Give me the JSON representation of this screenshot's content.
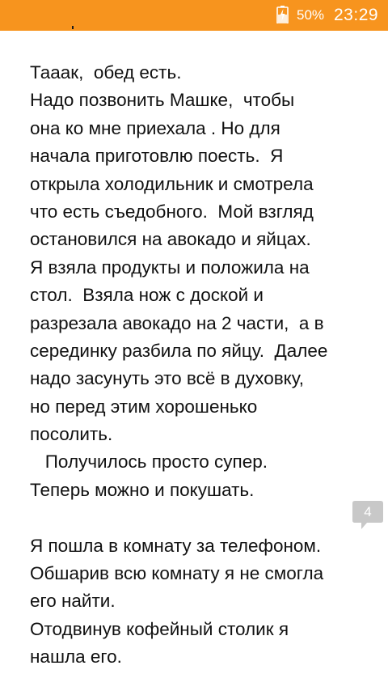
{
  "status_bar": {
    "battery": "50%",
    "time": "23:29",
    "color": "#F7941E"
  },
  "story": {
    "paragraph_1": [
      "Тааак,  обед есть.",
      "Надо позвонить Машке,  чтобы",
      "она ко мне приехала . Но для",
      "начала приготовлю поесть.  Я",
      "открыла холодильник и смотрела",
      "что есть съедобного.  Мой взгляд",
      "остановился на авокадо и яйцах.",
      "Я взяла продукты и положила на",
      "стол.  Взяла нож с доской и",
      "разрезала авокадо на 2 части,  а в",
      "серединку разбила по яйцу.  Далее",
      "надо засунуть это всё в духовку,",
      "но перед этим хорошенько",
      "посолить.",
      "   Получилось просто супер.",
      "Теперь можно и покушать."
    ],
    "paragraph_2": [
      "Я пошла в комнату за телефоном.",
      "Обшарив всю комнату я не смогла",
      "его найти.",
      "Отодвинув кофейный столик я",
      "нашла его."
    ]
  },
  "comment_badge": {
    "count": "4",
    "color": "#C8C8C8"
  }
}
